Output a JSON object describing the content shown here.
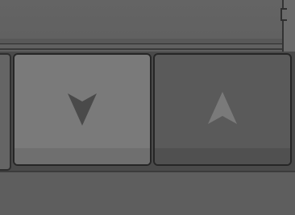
{
  "controls": {
    "down_button": {
      "icon": "down-arrow-icon",
      "state": "normal"
    },
    "up_button": {
      "icon": "up-arrow-icon",
      "state": "pressed"
    }
  },
  "colors": {
    "panel": "#5f5f5f",
    "button_normal": "#7a7a7a",
    "button_pressed": "#5a5a5a",
    "arrow_down": "#4a4a4a",
    "arrow_up": "#7a7a7a",
    "border": "#262626"
  }
}
